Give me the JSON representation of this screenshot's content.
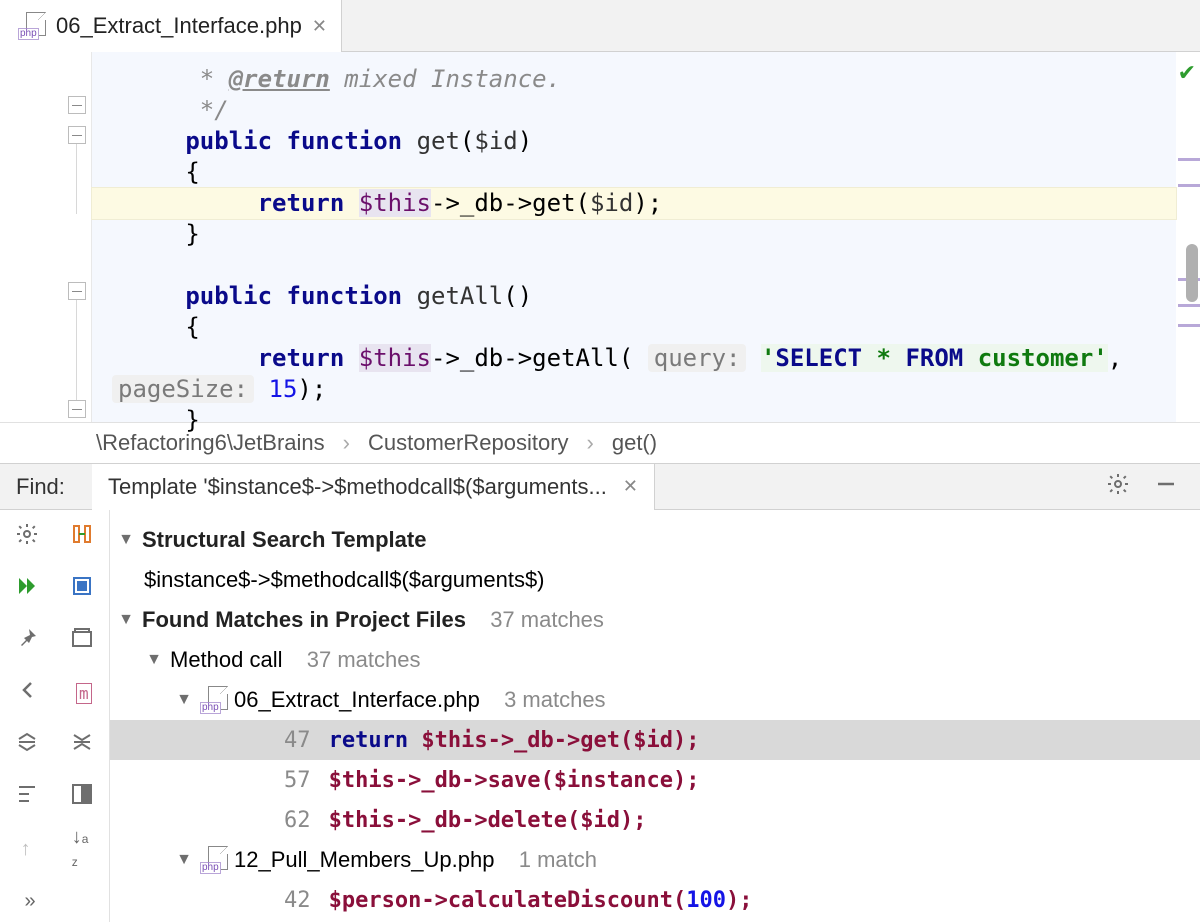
{
  "tab": {
    "filename": "06_Extract_Interface.php",
    "badge": "php"
  },
  "code": {
    "doc_return": "@return",
    "doc_text": " mixed Instance.",
    "doc_close": "*/",
    "kw_public": "public",
    "kw_function": "function",
    "fn_get": "get",
    "fn_getAll": "getAll",
    "param_id": "$id",
    "brace_open": "{",
    "brace_close": "}",
    "kw_return": "return",
    "this": "$this",
    "arrow": "->",
    "db": "_db",
    "call_get": "get",
    "call_getAll": "getAll",
    "hint_query": "query:",
    "sql_prefix": "'",
    "sql_select": "SELECT",
    "sql_star": " * ",
    "sql_from": "FROM",
    "sql_customer": " customer",
    "sql_suffix": "'",
    "hint_pagesize": "pageSize:",
    "page_size": "15",
    "paren_close_semi": ");",
    "empty_parens": "()"
  },
  "breadcrumb": {
    "p1": "\\Refactoring6\\JetBrains",
    "p2": "CustomerRepository",
    "p3": "get()"
  },
  "find": {
    "label": "Find:",
    "tab_label": "Template '$instance$->$methodcall$($arguments...",
    "header": "Structural Search Template",
    "template": "$instance$->$methodcall$($arguments$)",
    "found_label": "Found Matches in Project Files",
    "found_count": "37 matches",
    "groups": [
      {
        "label": "Method call",
        "count": "37 matches"
      }
    ],
    "files": [
      {
        "name": "06_Extract_Interface.php",
        "count": "3 matches",
        "lines": [
          {
            "n": "47",
            "pre_kw": "return ",
            "code": "$this->_db->get($id);"
          },
          {
            "n": "57",
            "pre_kw": "",
            "code": "$this->_db->save($instance);"
          },
          {
            "n": "62",
            "pre_kw": "",
            "code": "$this->_db->delete($id);"
          }
        ]
      },
      {
        "name": "12_Pull_Members_Up.php",
        "count": "1 match",
        "lines": [
          {
            "n": "42",
            "pre_kw": "",
            "code": "$person->calculateDiscount(",
            "num": "100",
            "tail": ");"
          }
        ]
      }
    ]
  }
}
